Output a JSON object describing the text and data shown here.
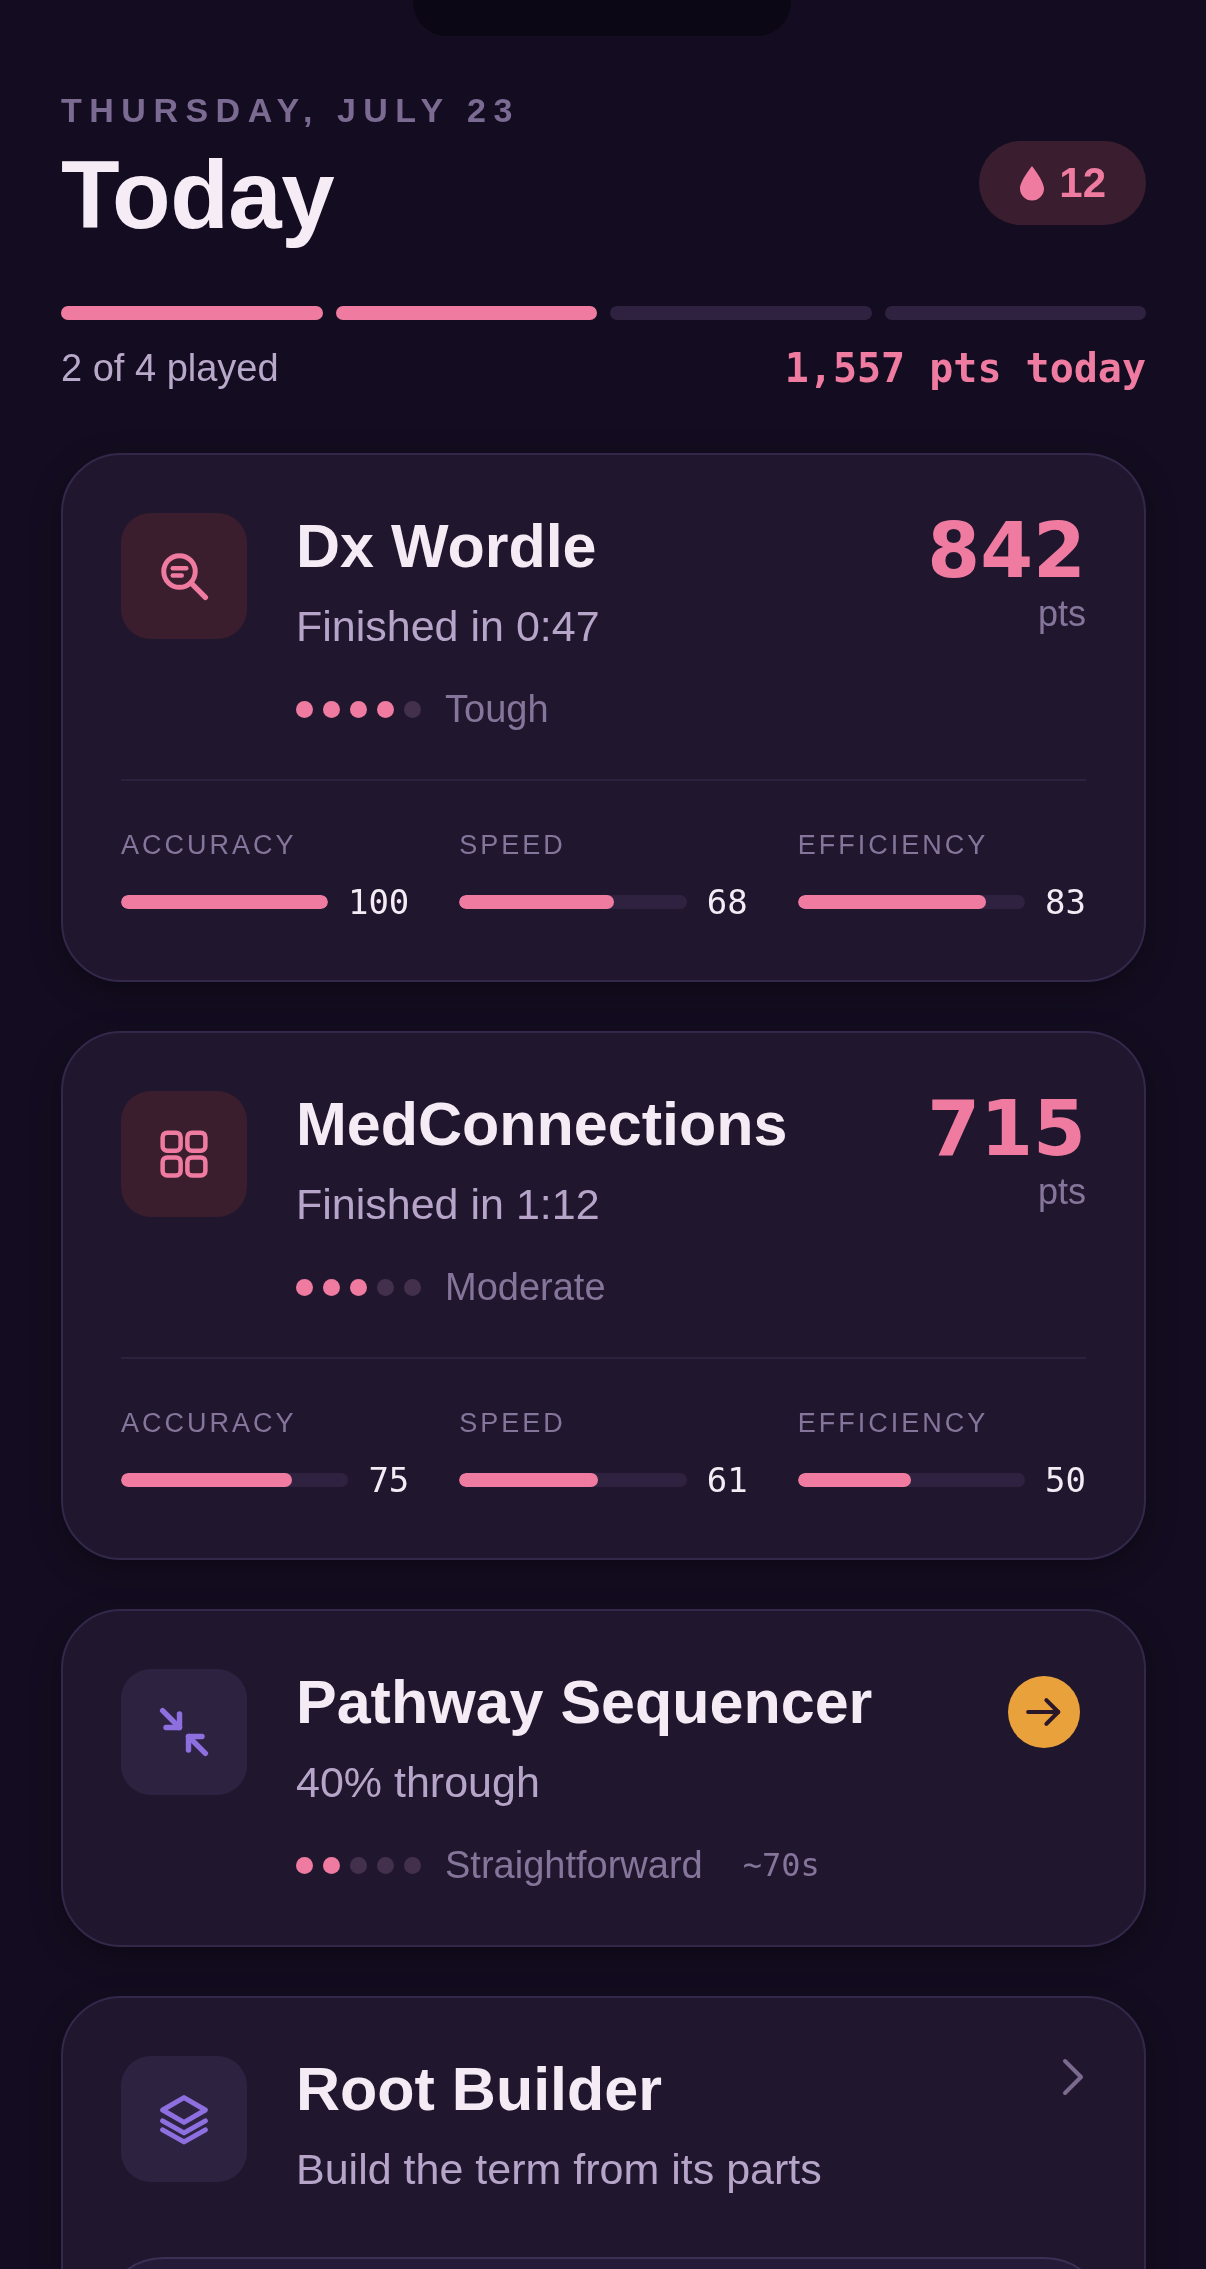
{
  "header": {
    "date": "THURSDAY, JULY 23",
    "title": "Today",
    "streak": "12"
  },
  "progress": {
    "segments": [
      {
        "filled": true
      },
      {
        "filled": true
      },
      {
        "filled": false
      },
      {
        "filled": false
      }
    ],
    "played": "2 of 4 played",
    "points": "1,557 pts today"
  },
  "games": [
    {
      "kind": "finished",
      "title": "Dx Wordle",
      "subtitle": "Finished in 0:47",
      "difficulty": {
        "stars": 4,
        "label": "Tough"
      },
      "score": "842",
      "score_unit": "pts",
      "metrics": [
        {
          "label": "ACCURACY",
          "level": 1,
          "reading": "100"
        },
        {
          "label": "SPEED",
          "level": 0.68,
          "reading": "68"
        },
        {
          "label": "EFFICIENCY",
          "level": 0.83,
          "reading": "83"
        }
      ]
    },
    {
      "kind": "finished",
      "title": "MedConnections",
      "subtitle": "Finished in 1:12",
      "difficulty": {
        "stars": 3,
        "label": "Moderate"
      },
      "score": "715",
      "score_unit": "pts",
      "metrics": [
        {
          "label": "ACCURACY",
          "level": 0.75,
          "reading": "75"
        },
        {
          "label": "SPEED",
          "level": 0.61,
          "reading": "61"
        },
        {
          "label": "EFFICIENCY",
          "level": 0.5,
          "reading": "50"
        }
      ]
    },
    {
      "kind": "in_progress",
      "title": "Pathway Sequencer",
      "subtitle": "40% through",
      "difficulty": {
        "stars": 2,
        "label": "Straightforward"
      },
      "duration": "~70s"
    },
    {
      "kind": "new",
      "title": "Root Builder",
      "subtitle": "Build the term from its parts"
    }
  ]
}
